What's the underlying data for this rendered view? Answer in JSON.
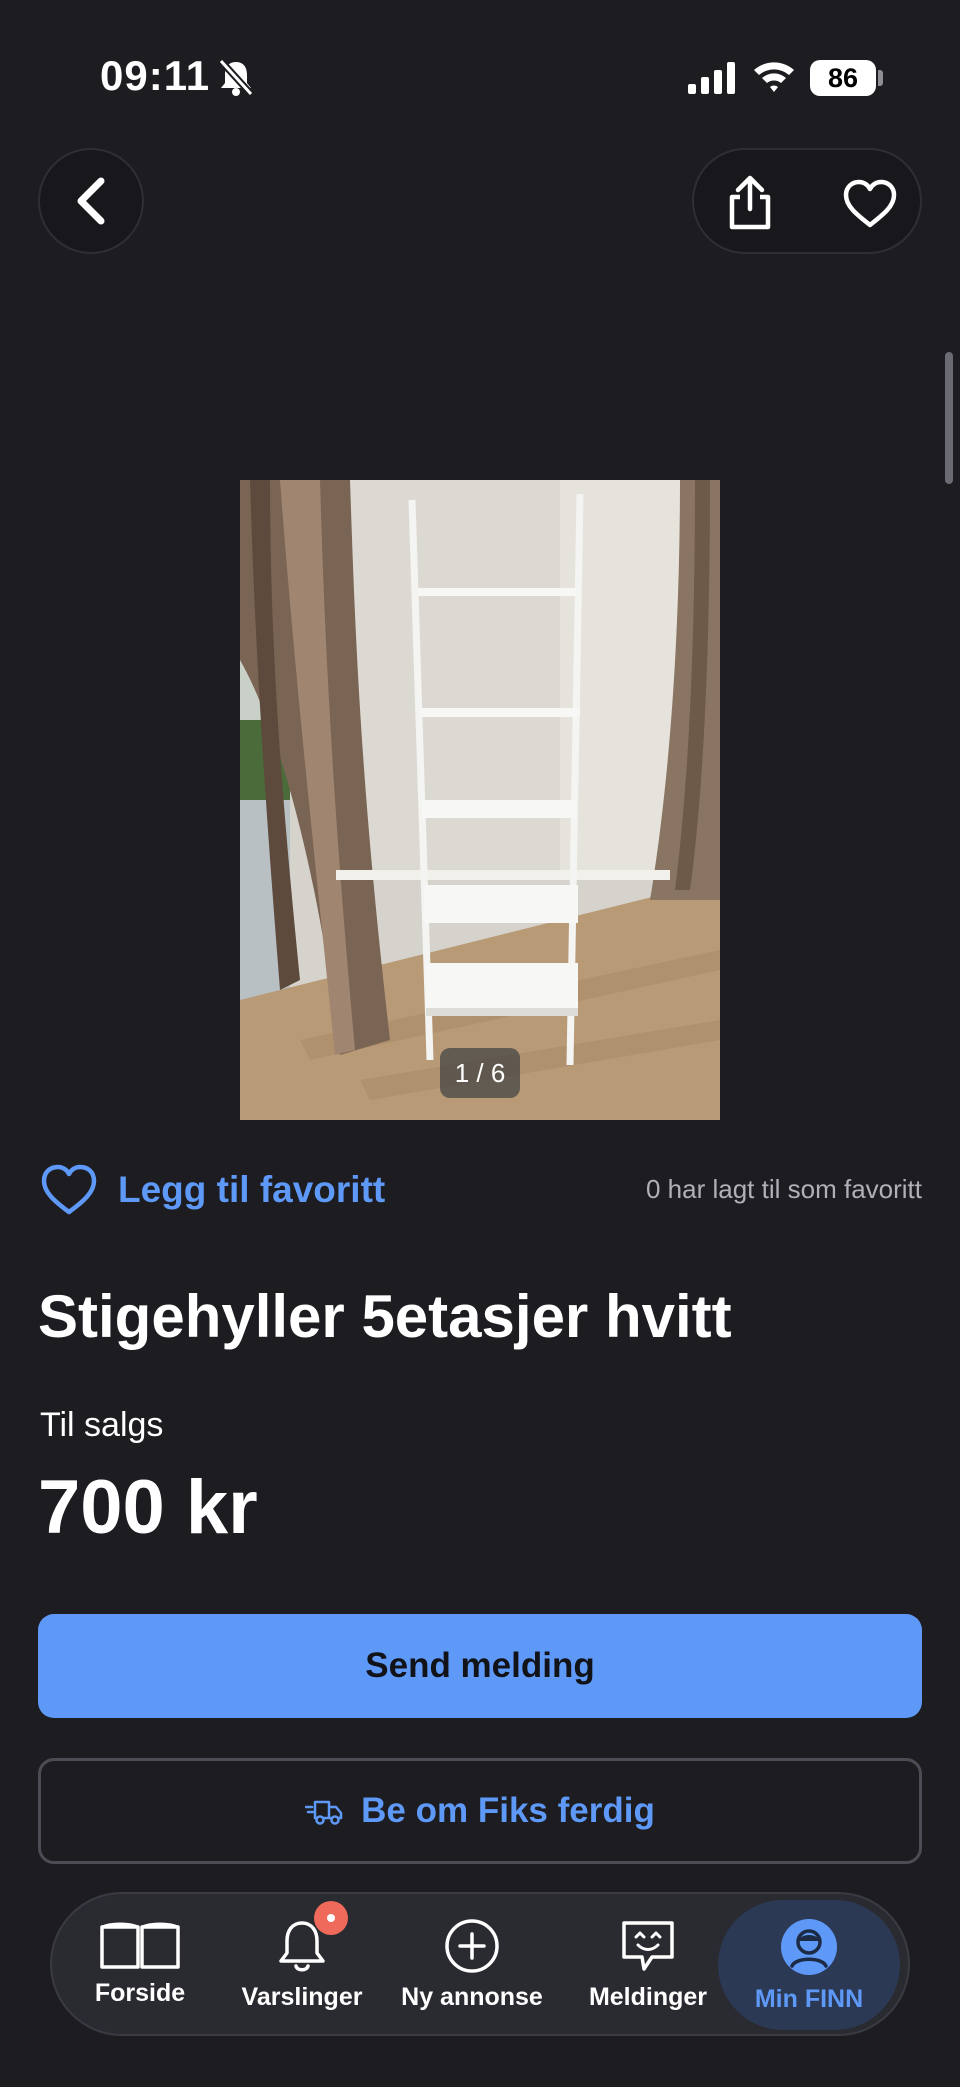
{
  "status_bar": {
    "time": "09:11",
    "battery": "86"
  },
  "nav": {
    "back_icon": "chevron-left-icon",
    "share_icon": "share-icon",
    "favorite_icon": "heart-icon"
  },
  "gallery": {
    "counter": "1 / 6",
    "current_index": 1,
    "total": 6
  },
  "favorite": {
    "add_label": "Legg til favoritt",
    "count_text": "0 har lagt til som favoritt"
  },
  "listing": {
    "title": "Stigehyller 5etasjer hvitt",
    "status": "Til salgs",
    "price": "700 kr"
  },
  "actions": {
    "send_message": "Send melding",
    "fiks_ferdig": "Be om Fiks ferdig"
  },
  "tabs": [
    {
      "label": "Forside",
      "icon": "book-icon",
      "active": false
    },
    {
      "label": "Varslinger",
      "icon": "bell-icon",
      "active": false,
      "badge": true
    },
    {
      "label": "Ny annonse",
      "icon": "plus-circle-icon",
      "active": false
    },
    {
      "label": "Meldinger",
      "icon": "chat-icon",
      "active": false
    },
    {
      "label": "Min FINN",
      "icon": "profile-icon",
      "active": true
    }
  ],
  "colors": {
    "background": "#1c1c21",
    "accent": "#5e99f7",
    "badge": "#ef6a5a"
  }
}
